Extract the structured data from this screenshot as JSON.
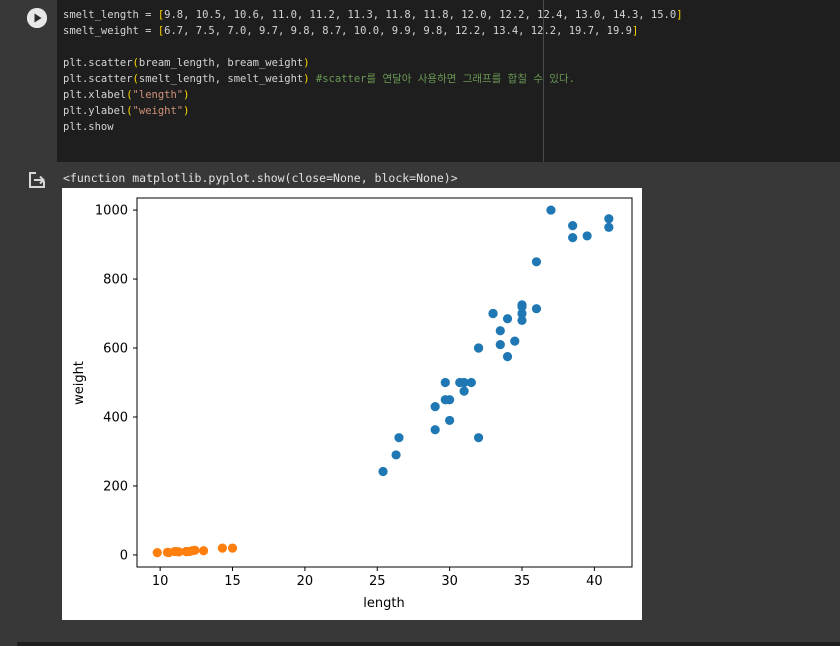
{
  "code": {
    "lines": [
      [
        {
          "t": "smelt_length = "
        },
        {
          "t": "[",
          "c": "c-br"
        },
        {
          "t": "9.8, 10.5, 10.6, 11.0, 11.2, 11.3, 11.8, 11.8, 12.0, 12.2, 12.4, 13.0, 14.3, 15.0"
        },
        {
          "t": "]",
          "c": "c-br"
        }
      ],
      [
        {
          "t": "smelt_weight = "
        },
        {
          "t": "[",
          "c": "c-br"
        },
        {
          "t": "6.7, 7.5, 7.0, 9.7, 9.8, 8.7, 10.0, 9.9, 9.8, 12.2, 13.4, 12.2, 19.7, 19.9"
        },
        {
          "t": "]",
          "c": "c-br"
        }
      ],
      [],
      [
        {
          "t": "plt.scatter"
        },
        {
          "t": "(",
          "c": "c-br"
        },
        {
          "t": "bream_length, bream_weight"
        },
        {
          "t": ")",
          "c": "c-br"
        }
      ],
      [
        {
          "t": "plt.scatter"
        },
        {
          "t": "(",
          "c": "c-br"
        },
        {
          "t": "smelt_length, smelt_weight"
        },
        {
          "t": ")",
          "c": "c-br"
        },
        {
          "t": " "
        },
        {
          "t": "#scatter를 연달아 사용하면 그래프를 합칠 수 있다.",
          "c": "c-com"
        }
      ],
      [
        {
          "t": "plt.xlabel"
        },
        {
          "t": "(",
          "c": "c-br"
        },
        {
          "t": "\"length\"",
          "c": "c-str"
        },
        {
          "t": ")",
          "c": "c-br"
        }
      ],
      [
        {
          "t": "plt.ylabel"
        },
        {
          "t": "(",
          "c": "c-br"
        },
        {
          "t": "\"weight\"",
          "c": "c-str"
        },
        {
          "t": ")",
          "c": "c-br"
        }
      ],
      [
        {
          "t": "plt.show"
        }
      ]
    ]
  },
  "output": {
    "text": "<function matplotlib.pyplot.show(close=None, block=None)>"
  },
  "icons": {
    "run": "play-circle-icon",
    "output": "output-redirect-icon"
  },
  "colors": {
    "series_blue": "#1f77b4",
    "series_orange": "#ff7f0e"
  },
  "chart_data": {
    "type": "scatter",
    "xlabel": "length",
    "ylabel": "weight",
    "xlim": [
      8.4,
      42.6
    ],
    "ylim": [
      -35,
      1035
    ],
    "xticks": [
      10,
      15,
      20,
      25,
      30,
      35,
      40
    ],
    "yticks": [
      0,
      200,
      400,
      600,
      800,
      1000
    ],
    "grid": false,
    "series": [
      {
        "color": "#1f77b4",
        "x": [
          25.4,
          26.3,
          26.5,
          29.0,
          29.0,
          29.7,
          29.7,
          30.0,
          30.0,
          30.7,
          31.0,
          31.0,
          31.5,
          32.0,
          32.0,
          32.0,
          33.0,
          33.0,
          33.5,
          33.5,
          34.0,
          34.0,
          34.5,
          35.0,
          35.0,
          35.0,
          35.0,
          36.0,
          36.0,
          37.0,
          38.5,
          38.5,
          39.5,
          41.0,
          41.0
        ],
        "y": [
          242,
          290,
          340,
          363,
          430,
          450,
          500,
          390,
          450,
          500,
          475,
          500,
          500,
          340,
          600,
          600,
          700,
          700,
          610,
          650,
          575,
          685,
          620,
          680,
          700,
          725,
          720,
          714,
          850,
          1000,
          920,
          955,
          925,
          975,
          950
        ]
      },
      {
        "color": "#ff7f0e",
        "x": [
          9.8,
          10.5,
          10.6,
          11.0,
          11.2,
          11.3,
          11.8,
          11.8,
          12.0,
          12.2,
          12.4,
          13.0,
          14.3,
          15.0
        ],
        "y": [
          6.7,
          7.5,
          7.0,
          9.7,
          9.8,
          8.7,
          10.0,
          9.9,
          9.8,
          12.2,
          13.4,
          12.2,
          19.7,
          19.9
        ]
      }
    ]
  }
}
